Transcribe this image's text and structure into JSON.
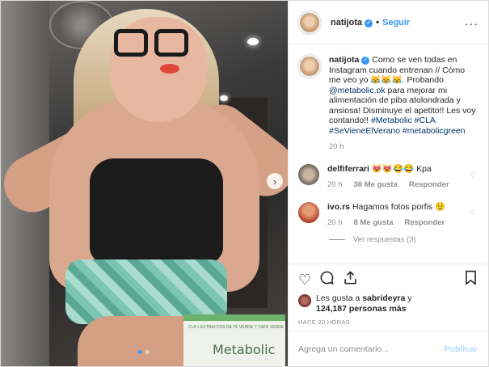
{
  "header": {
    "username": "natijota",
    "separator": "•",
    "follow_label": "Seguir",
    "more": "···"
  },
  "caption": {
    "username": "natijota",
    "text_1": "Como se ven todas en Instagram cuando entrenan // Cómo me veo yo 😹😹😹. Probando ",
    "mention": "@metabolic.ok",
    "text_2": " para mejorar mi alimentación de piba atolondrada y ansiosa! Disminuye el apetito!! Les voy contando!! ",
    "hashtags": "#Metabolic #CLA #SeVieneElVerano #metabolicgreen",
    "time": "20 h"
  },
  "comments": [
    {
      "username": "delfiferrari",
      "text": "😻😻😂😂 Kpa",
      "time": "20 h",
      "likes": "38 Me gusta",
      "reply": "Responder"
    },
    {
      "username": "ivo.rs",
      "text": "Hagamos fotos porfis 😟",
      "time": "20 h",
      "likes": "8 Me gusta",
      "reply": "Responder"
    }
  ],
  "view_replies": "Ver respuestas (3)",
  "likes_text_1": "Les gusta a ",
  "likes_user": "sabrideyra",
  "likes_text_2": " y ",
  "likes_count": "124,187 personas más",
  "posted": "HACE 20 HORAS",
  "add_comment": {
    "placeholder": "Agrega un comentario...",
    "publish": "Publicar"
  },
  "photo": {
    "box_small": "CLA + EXTRACTOS DE TÉ VERDE Y CAFÉ VERDE",
    "box_name": "Metabolic"
  },
  "icons": {
    "verified": "verified-badge-icon",
    "next": "chevron-right-icon",
    "like": "heart-icon",
    "comment": "comment-icon",
    "share": "share-icon",
    "save": "bookmark-icon"
  },
  "colors": {
    "accent": "#3897f0",
    "link": "#003569",
    "muted": "#8e8e8e",
    "publish_disabled": "#b3dbff"
  }
}
